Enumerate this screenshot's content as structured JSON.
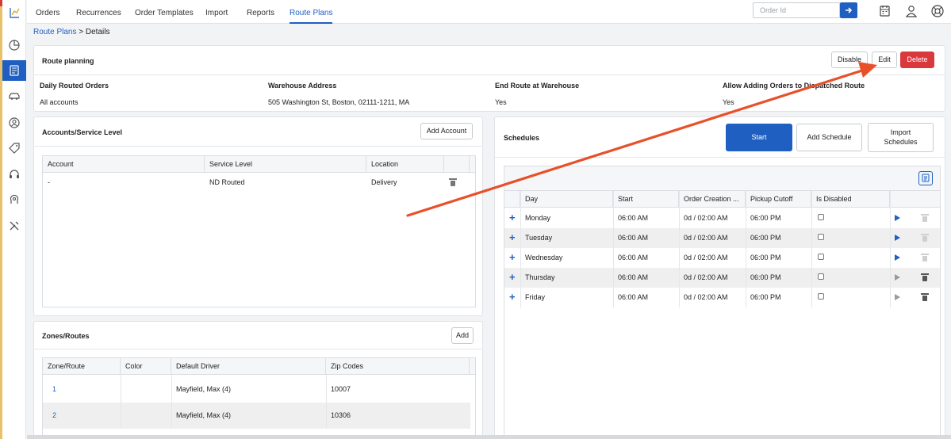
{
  "topnav": {
    "tabs": [
      {
        "label": "Orders"
      },
      {
        "label": "Recurrences"
      },
      {
        "label": "Order Templates"
      },
      {
        "label": "Import"
      },
      {
        "label": "Reports"
      },
      {
        "label": "Route Plans"
      }
    ],
    "order_id_placeholder": "Order Id"
  },
  "breadcrumb": {
    "link": "Route Plans",
    "current": "> Details"
  },
  "route_planning": {
    "title": "Route planning",
    "buttons": {
      "disable": "Disable",
      "edit": "Edit",
      "delete": "Delete"
    },
    "fields": [
      {
        "label": "Daily Routed Orders",
        "value": "All accounts"
      },
      {
        "label": "Warehouse Address",
        "value": "505 Washington St, Boston, 02111-1211, MA"
      },
      {
        "label": "End Route at Warehouse",
        "value": "Yes"
      },
      {
        "label": "Allow Adding Orders to Dispatched Route",
        "value": "Yes"
      }
    ]
  },
  "accounts": {
    "title": "Accounts/Service Level",
    "add_button": "Add Account",
    "columns": [
      "Account",
      "Service Level",
      "Location"
    ],
    "rows": [
      {
        "account": "-",
        "service_level": "ND Routed",
        "location": "Delivery"
      }
    ]
  },
  "zones": {
    "title": "Zones/Routes",
    "add_button": "Add",
    "columns": [
      "Zone/Route",
      "Color",
      "Default Driver",
      "Zip Codes"
    ],
    "rows": [
      {
        "zone": "1",
        "color": "",
        "driver": "Mayfield, Max (4)",
        "zip": "10007"
      },
      {
        "zone": "2",
        "color": "",
        "driver": "Mayfield, Max (4)",
        "zip": "10306"
      }
    ]
  },
  "schedules": {
    "title": "Schedules",
    "buttons": {
      "start": "Start",
      "add": "Add Schedule",
      "import_line1": "Import",
      "import_line2": "Schedules"
    },
    "columns": [
      "Day",
      "Start",
      "Order Creation ...",
      "Pickup Cutoff",
      "Is Disabled"
    ],
    "rows": [
      {
        "day": "Monday",
        "start": "06:00 AM",
        "order_creation": "0d / 02:00 AM",
        "pickup_cutoff": "06:00 PM",
        "disabled": false,
        "active": true
      },
      {
        "day": "Tuesday",
        "start": "06:00 AM",
        "order_creation": "0d / 02:00 AM",
        "pickup_cutoff": "06:00 PM",
        "disabled": false,
        "active": true
      },
      {
        "day": "Wednesday",
        "start": "06:00 AM",
        "order_creation": "0d / 02:00 AM",
        "pickup_cutoff": "06:00 PM",
        "disabled": false,
        "active": true
      },
      {
        "day": "Thursday",
        "start": "06:00 AM",
        "order_creation": "0d / 02:00 AM",
        "pickup_cutoff": "06:00 PM",
        "disabled": false,
        "active": false
      },
      {
        "day": "Friday",
        "start": "06:00 AM",
        "order_creation": "0d / 02:00 AM",
        "pickup_cutoff": "06:00 PM",
        "disabled": false,
        "active": false
      }
    ]
  },
  "icons": {
    "sidebar": [
      "route-map-icon",
      "dashboard-chart-icon",
      "orders-list-icon",
      "vehicle-icon",
      "user-circle-icon",
      "tag-icon",
      "support-headset-icon",
      "settings-brain-icon",
      "tools-icon"
    ],
    "top": [
      "calendar-icon",
      "user-icon",
      "help-lifebuoy-icon"
    ]
  },
  "colors": {
    "accent": "#1f5fc2",
    "danger": "#d9393c",
    "annotation_arrow": "#e8502a"
  }
}
